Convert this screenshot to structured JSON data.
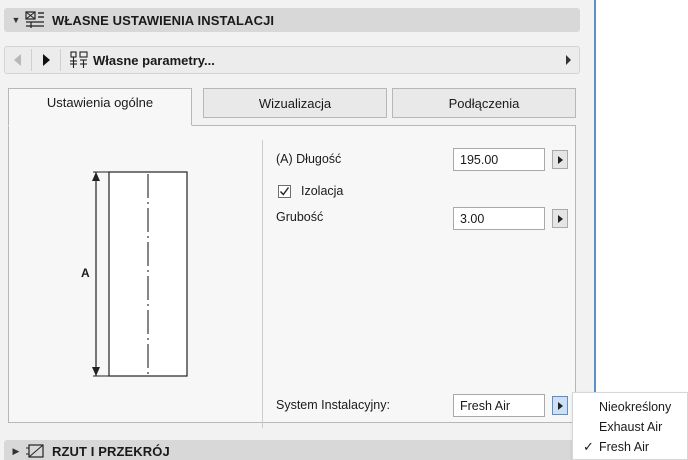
{
  "header": {
    "title": "WŁASNE USTAWIENIA INSTALACJI",
    "icon": "duct-settings-icon"
  },
  "navbar": {
    "title": "Własne parametry...",
    "prev_icon": "prev-arrow-icon",
    "next_icon": "next-arrow-icon",
    "params_icon": "parameters-icon"
  },
  "tabs": [
    {
      "label": "Ustawienia ogólne",
      "active": true
    },
    {
      "label": "Wizualizacja",
      "active": false
    },
    {
      "label": "Podłączenia",
      "active": false
    }
  ],
  "diagram": {
    "dimension_label": "A"
  },
  "fields": {
    "length": {
      "label": "(A) Długość",
      "value": "195.00"
    },
    "insulation": {
      "label": "Izolacja",
      "checked": true
    },
    "thickness": {
      "label": "Grubość",
      "value": "3.00"
    },
    "system": {
      "label": "System Instalacyjny:",
      "value": "Fresh Air"
    }
  },
  "dropdown": {
    "options": [
      "Nieokreślony",
      "Exhaust Air",
      "Fresh Air"
    ],
    "selected": "Fresh Air"
  },
  "footer": {
    "title": "RZUT I PRZEKRÓJ",
    "icon": "plan-section-icon"
  },
  "colors": {
    "accent": "#5b8fc7",
    "header_bg": "#d8d8d8",
    "panel_bg": "#f2f2f2"
  }
}
